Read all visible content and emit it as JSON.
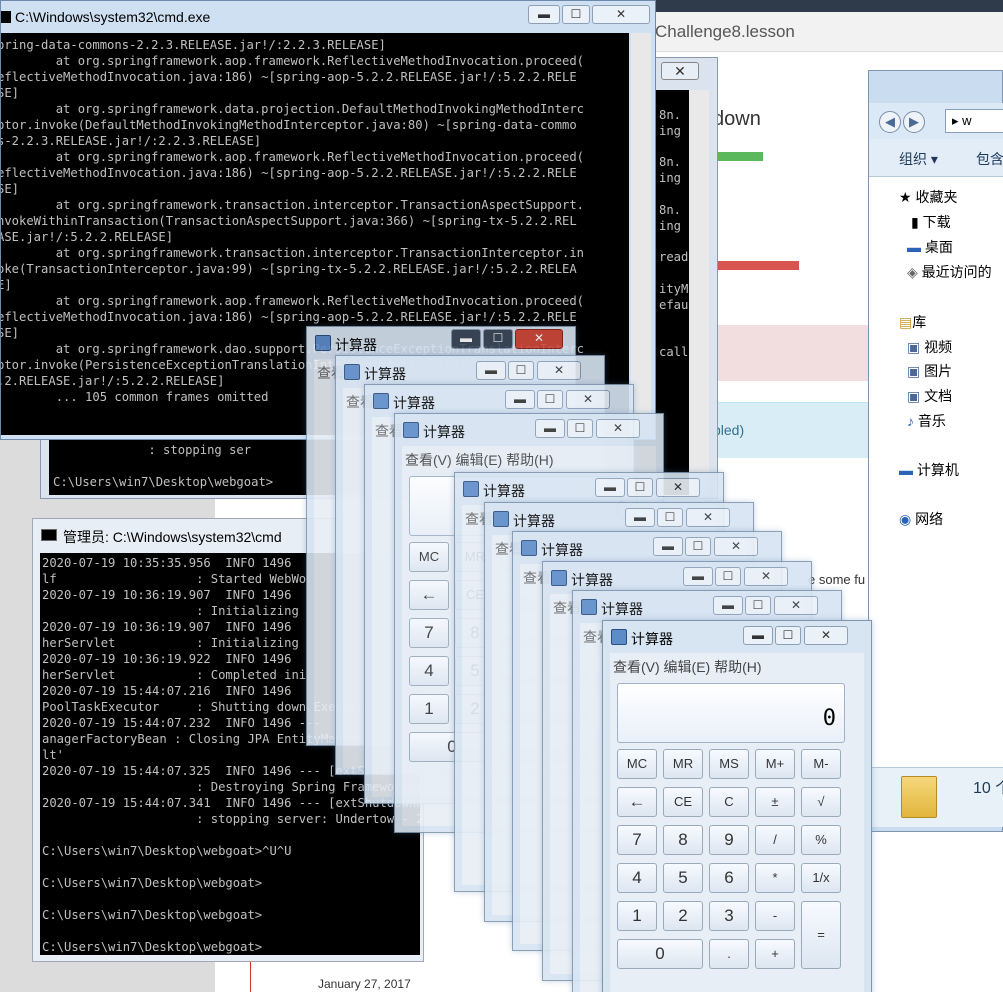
{
  "browser": {
    "tab_title": "Challenge8.lesson",
    "heading": "kdown",
    "blue_banner_text": "bled)",
    "side_text": "e some fu",
    "date_caption": "January 27, 2017",
    "bar_green": "#5cb85c",
    "bar_red": "#d9534f"
  },
  "explorer": {
    "address": "▸ w",
    "toolbar_organize": "组织 ▾",
    "toolbar_include": "包含",
    "favorites": "收藏夹",
    "downloads": "下载",
    "desktop": "桌面",
    "recent": "最近访问的",
    "libraries": "库",
    "videos": "视频",
    "pictures": "图片",
    "documents": "文档",
    "music": "音乐",
    "computer": "计算机",
    "network": "网络",
    "item_count": "10 个"
  },
  "cmd1": {
    "title": "C:\\Windows\\system32\\cmd.exe",
    "lines": [
      "pring-data-commons-2.2.3.RELEASE.jar!/:2.2.3.RELEASE]",
      "        at org.springframework.aop.framework.ReflectiveMethodInvocation.proceed(",
      "eflectiveMethodInvocation.java:186) ~[spring-aop-5.2.2.RELEASE.jar!/:5.2.2.RELE",
      "SE]",
      "        at org.springframework.data.projection.DefaultMethodInvokingMethodInterc",
      "ptor.invoke(DefaultMethodInvokingMethodInterceptor.java:80) ~[spring-data-commo",
      "s-2.2.3.RELEASE.jar!/:2.2.3.RELEASE]",
      "        at org.springframework.aop.framework.ReflectiveMethodInvocation.proceed(",
      "eflectiveMethodInvocation.java:186) ~[spring-aop-5.2.2.RELEASE.jar!/:5.2.2.RELE",
      "SE]",
      "        at org.springframework.transaction.interceptor.TransactionAspectSupport.",
      "nvokeWithinTransaction(TransactionAspectSupport.java:366) ~[spring-tx-5.2.2.REL",
      "ASE.jar!/:5.2.2.RELEASE]",
      "        at org.springframework.transaction.interceptor.TransactionInterceptor.in",
      "oke(TransactionInterceptor.java:99) ~[spring-tx-5.2.2.RELEASE.jar!/:5.2.2.RELEA",
      "E]",
      "        at org.springframework.aop.framework.ReflectiveMethodInvocation.proceed(",
      "eflectiveMethodInvocation.java:186) ~[spring-aop-5.2.2.RELEASE.jar!/:5.2.2.RELE",
      "SE]",
      "        at org.springframework.dao.support.PersistenceExceptionTranslationInterc",
      "ptor.invoke(PersistenceExceptionTranslationInterceptor.java:139) ~[spring-tx-5.",
      ".2.RELEASE.jar!/:5.2.2.RELEASE]",
      "        ... 105 common frames omitted"
    ]
  },
  "cmd_mid": {
    "right_lines": [
      "8n.",
      "ing",
      "",
      "8n.",
      "ing",
      "",
      "8n.",
      "ing",
      "",
      "read",
      "",
      "ityM",
      "efau",
      "",
      "",
      "call"
    ],
    "bottom_lines": [
      "             : stopping ser",
      "",
      "C:\\Users\\win7\\Desktop\\webgoat>"
    ]
  },
  "cmd2": {
    "title": "管理员: C:\\Windows\\system32\\cmd",
    "lines": [
      "2020-07-19 10:35:35.956  INFO 1496",
      "lf                   : Started WebWo",
      "2020-07-19 10:36:19.907  INFO 1496",
      "                     : Initializing",
      "2020-07-19 10:36:19.907  INFO 1496",
      "herServlet           : Initializing",
      "2020-07-19 10:36:19.922  INFO 1496",
      "herServlet           : Completed ini",
      "2020-07-19 15:44:07.216  INFO 1496",
      "PoolTaskExecutor     : Shutting down ExecutorService",
      "2020-07-19 15:44:07.232  INFO 1496 ---",
      "anagerFactoryBean : Closing JPA EntityManagerFactory",
      "lt'",
      "2020-07-19 15:44:07.325  INFO 1496 --- [extShutdownHook]",
      "                     : Destroying Spring FrameworkServlet",
      "2020-07-19 15:44:07.341  INFO 1496 --- [extShutdownHook]",
      "                     : stopping server: Undertow - 2.0.28",
      "",
      "C:\\Users\\win7\\Desktop\\webgoat>^U^U",
      "",
      "C:\\Users\\win7\\Desktop\\webgoat>",
      "",
      "C:\\Users\\win7\\Desktop\\webgoat>",
      "",
      "C:\\Users\\win7\\Desktop\\webgoat>"
    ]
  },
  "calc": {
    "title": "计算器",
    "menu": "查看(V)  编辑(E)  帮助(H)",
    "menu_short": "查看",
    "display": "0",
    "keys": {
      "mc": "MC",
      "mr": "MR",
      "ms": "MS",
      "mplus": "M+",
      "mminus": "M-",
      "back": "←",
      "ce": "CE",
      "c": "C",
      "pm": "±",
      "sqrt": "√",
      "k7": "7",
      "k8": "8",
      "k9": "9",
      "div": "/",
      "pct": "%",
      "k4": "4",
      "k5": "5",
      "k6": "6",
      "mul": "*",
      "inv": "1/x",
      "k1": "1",
      "k2": "2",
      "k3": "3",
      "sub": "-",
      "eq": "=",
      "k0": "0",
      "dot": ".",
      "add": "+"
    }
  }
}
